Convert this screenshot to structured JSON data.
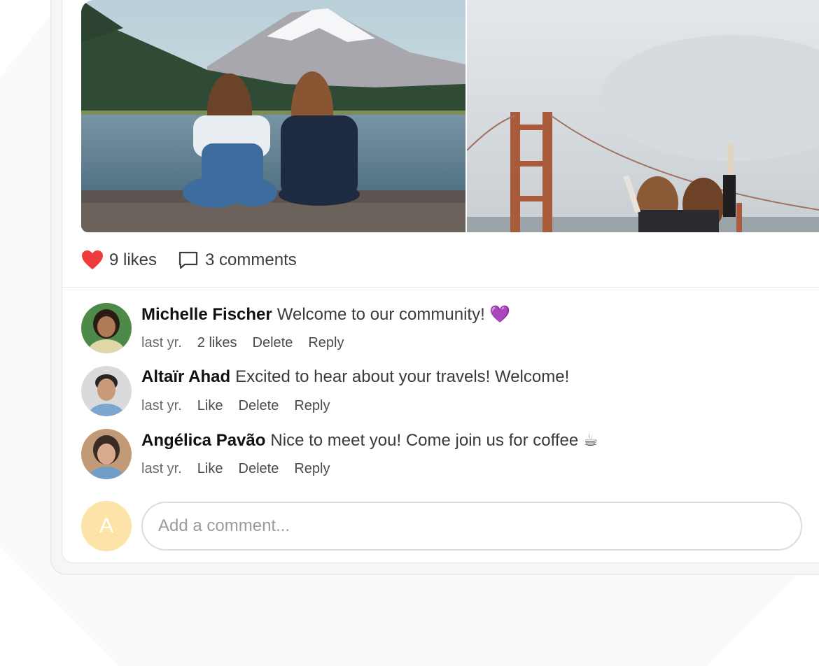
{
  "post": {
    "likes_label": "9 likes",
    "comments_label": "3 comments",
    "colors": {
      "heart": "#ef3b3b",
      "author_text": "#111111",
      "body_text": "#3a3a3a",
      "avatar_placeholder_bg": "#fde3a7"
    }
  },
  "comments": [
    {
      "author": "Michelle Fischer",
      "text": "Welcome to our community! 💜",
      "time": "last yr.",
      "actions": [
        "2 likes",
        "Delete",
        "Reply"
      ]
    },
    {
      "author": "Altaïr Ahad",
      "text": "Excited to hear about your travels! Welcome!",
      "time": "last yr.",
      "actions": [
        "Like",
        "Delete",
        "Reply"
      ]
    },
    {
      "author": "Angélica Pavão",
      "text": "Nice to meet you! Come join us for coffee ☕",
      "time": "last yr.",
      "actions": [
        "Like",
        "Delete",
        "Reply"
      ]
    }
  ],
  "composer": {
    "avatar_initial": "A",
    "placeholder": "Add a comment..."
  },
  "icons": {
    "likes": "heart-icon",
    "comments": "speech-bubble-icon"
  }
}
